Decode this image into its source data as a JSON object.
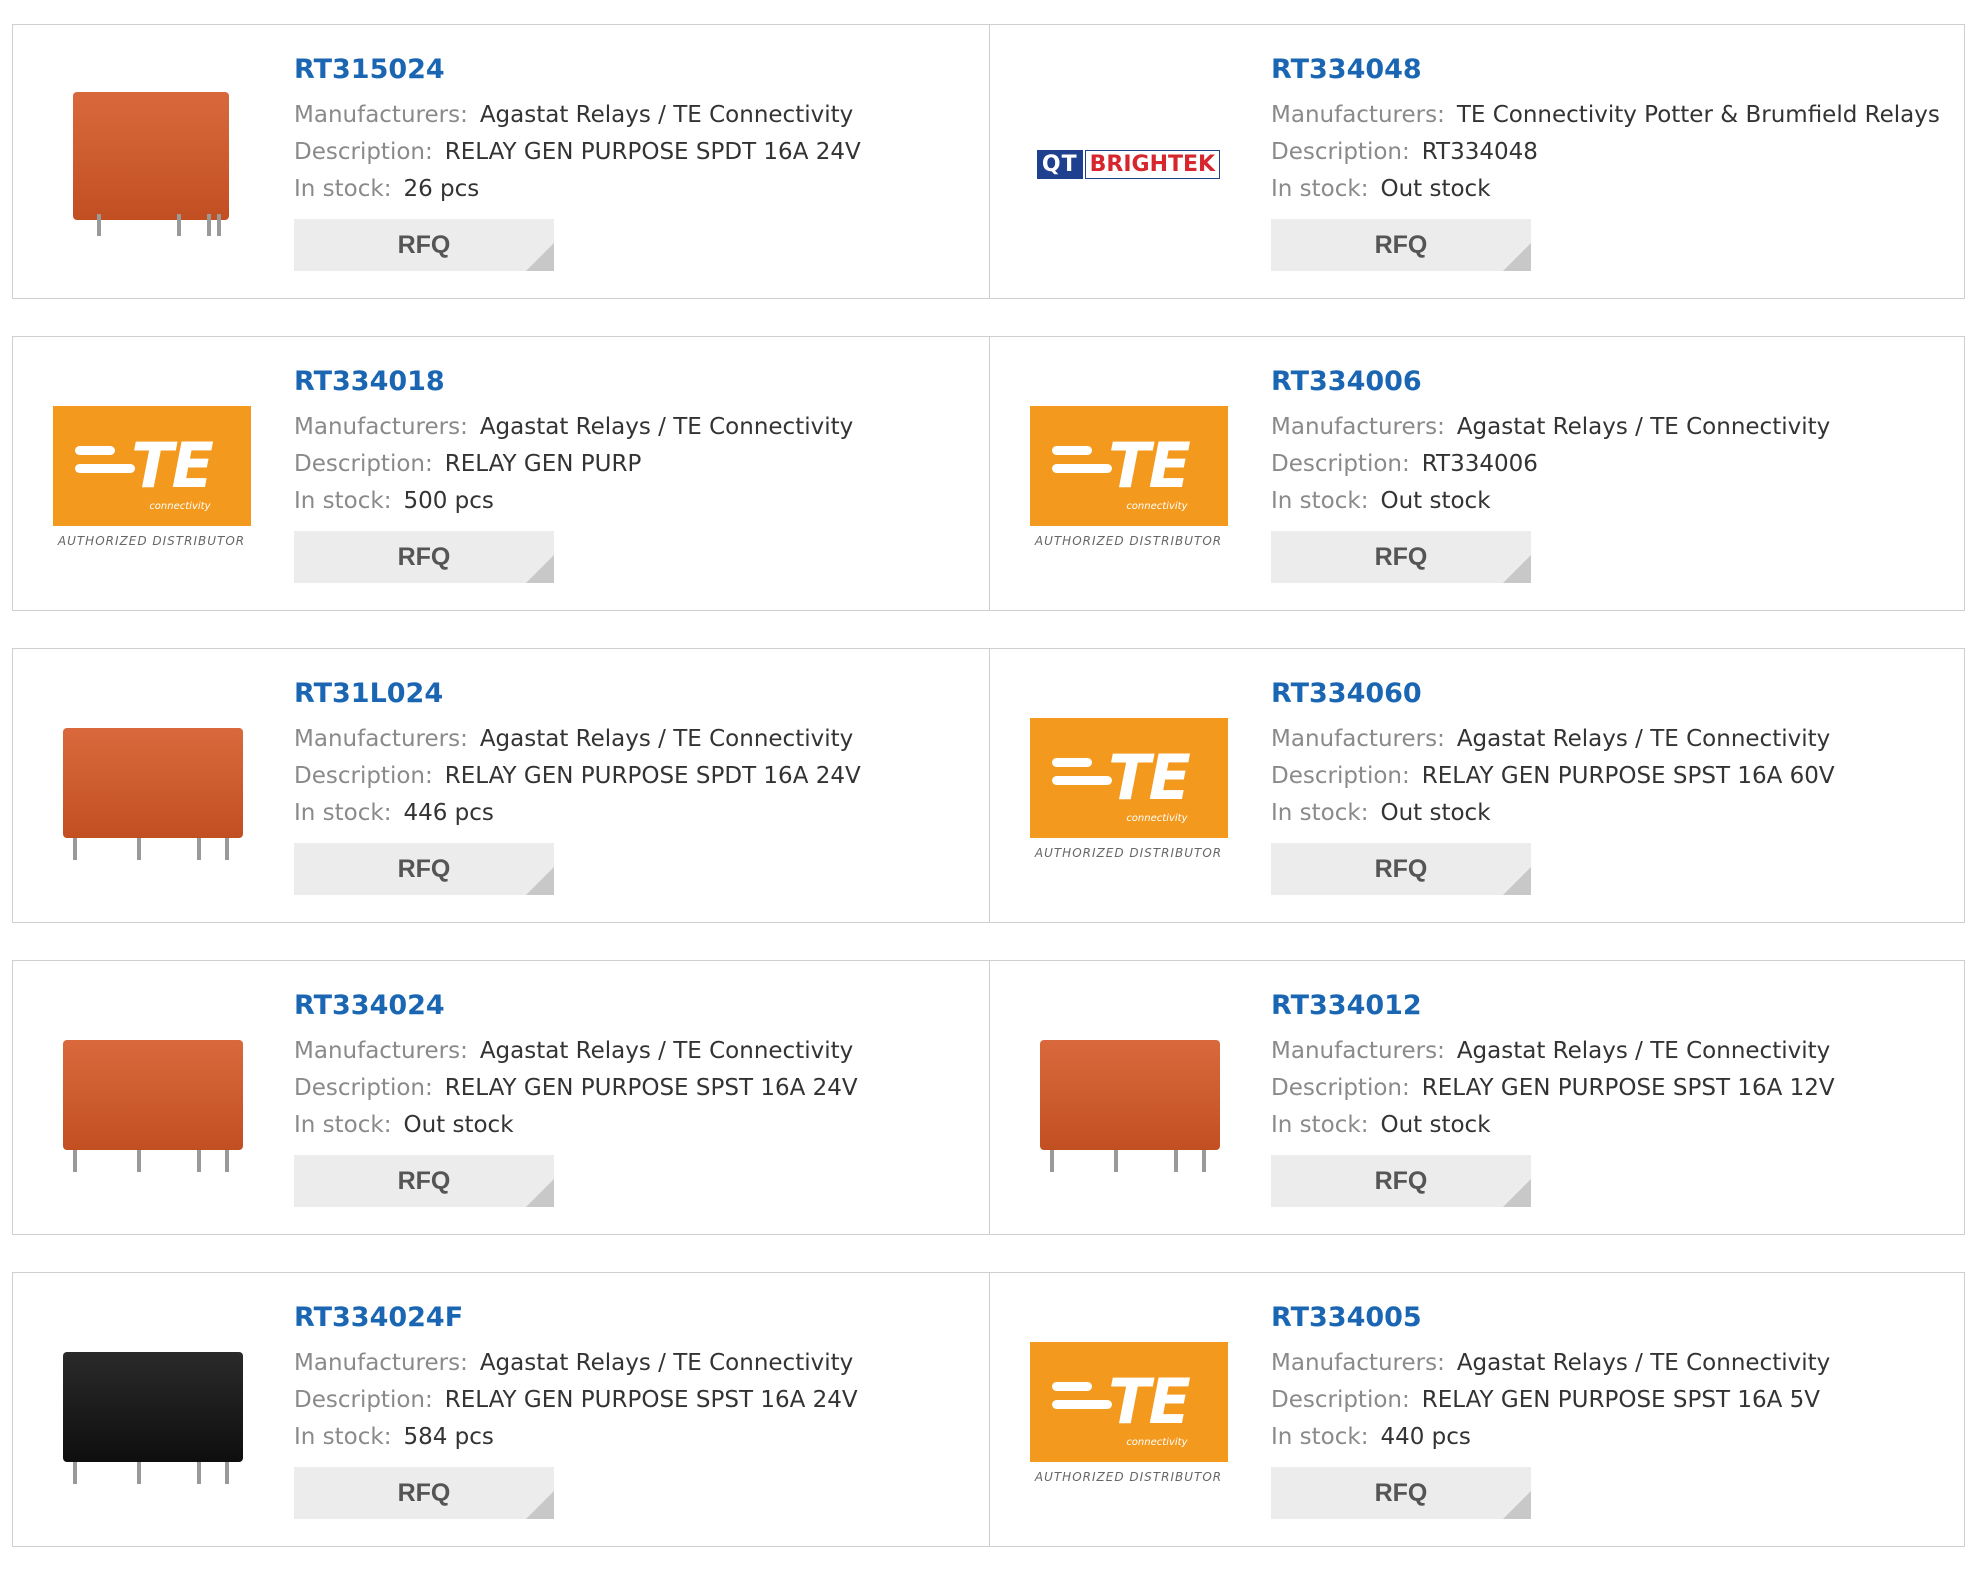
{
  "labels": {
    "manufacturers": "Manufacturers:",
    "description": "Description:",
    "in_stock": "In stock:",
    "rfq": "RFQ"
  },
  "logos": {
    "te_mark": "TE",
    "te_sub": "connectivity",
    "te_auth": "AUTHORIZED DISTRIBUTOR",
    "qt_q": "QT",
    "qt_b": "BRIGHTEK"
  },
  "products": [
    {
      "part": "RT315024",
      "manufacturer": "Agastat Relays / TE Connectivity",
      "description": "RELAY GEN PURPOSE SPDT 16A 24V",
      "stock": "26 pcs",
      "image": "orange-relay-tall-icon"
    },
    {
      "part": "RT334048",
      "manufacturer": "TE Connectivity Potter & Brumfield Relays",
      "description": "RT334048",
      "stock": "Out stock",
      "image": "qt-brightek-logo"
    },
    {
      "part": "RT334018",
      "manufacturer": "Agastat Relays / TE Connectivity",
      "description": "RELAY GEN PURP",
      "stock": "500 pcs",
      "image": "te-connectivity-logo"
    },
    {
      "part": "RT334006",
      "manufacturer": "Agastat Relays / TE Connectivity",
      "description": "RT334006",
      "stock": "Out stock",
      "image": "te-connectivity-logo"
    },
    {
      "part": "RT31L024",
      "manufacturer": "Agastat Relays / TE Connectivity",
      "description": "RELAY GEN PURPOSE SPDT 16A 24V",
      "stock": "446 pcs",
      "image": "orange-relay-icon"
    },
    {
      "part": "RT334060",
      "manufacturer": "Agastat Relays / TE Connectivity",
      "description": "RELAY GEN PURPOSE SPST 16A 60V",
      "stock": "Out stock",
      "image": "te-connectivity-logo"
    },
    {
      "part": "RT334024",
      "manufacturer": "Agastat Relays / TE Connectivity",
      "description": "RELAY GEN PURPOSE SPST 16A 24V",
      "stock": "Out stock",
      "image": "orange-relay-icon"
    },
    {
      "part": "RT334012",
      "manufacturer": "Agastat Relays / TE Connectivity",
      "description": "RELAY GEN PURPOSE SPST 16A 12V",
      "stock": "Out stock",
      "image": "orange-relay-icon"
    },
    {
      "part": "RT334024F",
      "manufacturer": "Agastat Relays / TE Connectivity",
      "description": "RELAY GEN PURPOSE SPST 16A 24V",
      "stock": "584 pcs",
      "image": "black-relay-icon"
    },
    {
      "part": "RT334005",
      "manufacturer": "Agastat Relays / TE Connectivity",
      "description": "RELAY GEN PURPOSE SPST 16A 5V",
      "stock": "440 pcs",
      "image": "te-connectivity-logo"
    }
  ]
}
